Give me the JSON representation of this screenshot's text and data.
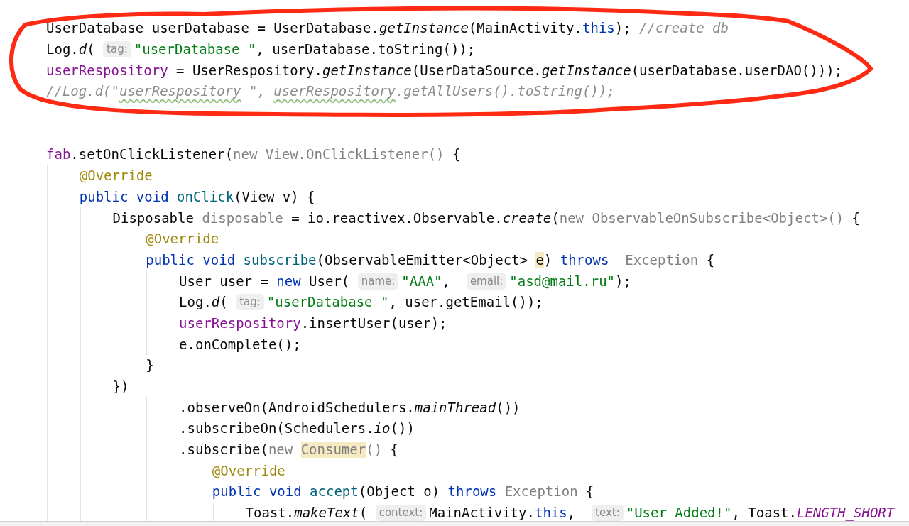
{
  "editor": {
    "lines": [
      {
        "kind": "code",
        "tokens": [
          {
            "kind": "code",
            "text": "UserDatabase userDatabase = UserDatabase.",
            "color": "#080808"
          },
          {
            "kind": "code",
            "text": "getInstance",
            "color": "#080808",
            "italic": true
          },
          {
            "kind": "code",
            "text": "(MainActivity.",
            "color": "#080808"
          },
          {
            "kind": "code",
            "text": "this",
            "color": "#0033b3"
          },
          {
            "kind": "code",
            "text": "); ",
            "color": "#080808"
          },
          {
            "kind": "code",
            "text": "//create db",
            "color": "#8c8c8c",
            "italic": true
          }
        ]
      },
      {
        "kind": "code",
        "tokens": [
          {
            "kind": "code",
            "text": "Log.",
            "color": "#080808"
          },
          {
            "kind": "code",
            "text": "d",
            "color": "#080808",
            "italic": true
          },
          {
            "kind": "code",
            "text": "( ",
            "color": "#080808"
          },
          {
            "kind": "hint",
            "text": "tag:"
          },
          {
            "kind": "code",
            "text": "\"userDatabase \"",
            "color": "#067d17"
          },
          {
            "kind": "code",
            "text": ", userDatabase.toString());",
            "color": "#080808"
          }
        ]
      },
      {
        "kind": "code",
        "tokens": [
          {
            "kind": "code",
            "text": "userRespository",
            "color": "#871094"
          },
          {
            "kind": "code",
            "text": " = UserRespository.",
            "color": "#080808"
          },
          {
            "kind": "code",
            "text": "getInstance",
            "color": "#080808",
            "italic": true
          },
          {
            "kind": "code",
            "text": "(UserDataSource.",
            "color": "#080808"
          },
          {
            "kind": "code",
            "text": "getInstance",
            "color": "#080808",
            "italic": true
          },
          {
            "kind": "code",
            "text": "(userDatabase.userDAO()));",
            "color": "#080808"
          }
        ]
      },
      {
        "kind": "code",
        "tokens": [
          {
            "kind": "code",
            "text": "//Log.d(\"",
            "color": "#8c8c8c",
            "italic": true
          },
          {
            "kind": "code",
            "text": "userRespository",
            "color": "#8c8c8c",
            "italic": true,
            "misspelled": true
          },
          {
            "kind": "code",
            "text": " \", ",
            "color": "#8c8c8c",
            "italic": true
          },
          {
            "kind": "code",
            "text": "userRespository",
            "color": "#8c8c8c",
            "italic": true,
            "misspelled": true
          },
          {
            "kind": "code",
            "text": ".getAllUsers().toString());",
            "color": "#8c8c8c",
            "italic": true
          }
        ]
      },
      {
        "kind": "blank"
      },
      {
        "kind": "blank"
      },
      {
        "kind": "code",
        "tokens": [
          {
            "kind": "code",
            "text": "fab",
            "color": "#871094"
          },
          {
            "kind": "code",
            "text": ".setOnClickListener(",
            "color": "#080808"
          },
          {
            "kind": "code",
            "text": "new View.OnClickListener()",
            "color": "#808080"
          },
          {
            "kind": "code",
            "text": " {",
            "color": "#080808"
          }
        ]
      },
      {
        "kind": "code",
        "tokens": [
          {
            "kind": "code",
            "text": "    @Override",
            "color": "#9e880d"
          }
        ]
      },
      {
        "kind": "code",
        "tokens": [
          {
            "kind": "code",
            "text": "    public void ",
            "color": "#0033b3"
          },
          {
            "kind": "code",
            "text": "onClick",
            "color": "#00627a"
          },
          {
            "kind": "code",
            "text": "(View v) {",
            "color": "#080808"
          }
        ]
      },
      {
        "kind": "code",
        "tokens": [
          {
            "kind": "code",
            "text": "        Disposable ",
            "color": "#080808"
          },
          {
            "kind": "code",
            "text": "disposable",
            "color": "#808080"
          },
          {
            "kind": "code",
            "text": " = io.reactivex.Observable.",
            "color": "#080808"
          },
          {
            "kind": "code",
            "text": "create",
            "color": "#080808",
            "italic": true
          },
          {
            "kind": "code",
            "text": "(",
            "color": "#080808"
          },
          {
            "kind": "code",
            "text": "new ObservableOnSubscribe<Object>()",
            "color": "#808080"
          },
          {
            "kind": "code",
            "text": " {",
            "color": "#080808"
          }
        ]
      },
      {
        "kind": "code",
        "tokens": [
          {
            "kind": "code",
            "text": "            @Override",
            "color": "#9e880d"
          }
        ]
      },
      {
        "kind": "code",
        "tokens": [
          {
            "kind": "code",
            "text": "            public void ",
            "color": "#0033b3"
          },
          {
            "kind": "code",
            "text": "subscribe",
            "color": "#00627a"
          },
          {
            "kind": "code",
            "text": "(ObservableEmitter<Object> ",
            "color": "#080808"
          },
          {
            "kind": "code",
            "text": "e",
            "color": "#080808",
            "highlighted": true
          },
          {
            "kind": "code",
            "text": ") ",
            "color": "#080808"
          },
          {
            "kind": "code",
            "text": "throws",
            "color": "#0033b3"
          },
          {
            "kind": "code",
            "text": "  Exception",
            "color": "#808080"
          },
          {
            "kind": "code",
            "text": " {",
            "color": "#080808"
          }
        ]
      },
      {
        "kind": "code",
        "tokens": [
          {
            "kind": "code",
            "text": "                User user = ",
            "color": "#080808"
          },
          {
            "kind": "code",
            "text": "new",
            "color": "#0033b3"
          },
          {
            "kind": "code",
            "text": " User( ",
            "color": "#080808"
          },
          {
            "kind": "hint",
            "text": "name:"
          },
          {
            "kind": "code",
            "text": "\"AAA\"",
            "color": "#067d17"
          },
          {
            "kind": "code",
            "text": ",  ",
            "color": "#080808"
          },
          {
            "kind": "hint",
            "text": "email:"
          },
          {
            "kind": "code",
            "text": "\"asd@mail.ru\"",
            "color": "#067d17"
          },
          {
            "kind": "code",
            "text": ");",
            "color": "#080808"
          }
        ]
      },
      {
        "kind": "code",
        "tokens": [
          {
            "kind": "code",
            "text": "                Log.",
            "color": "#080808"
          },
          {
            "kind": "code",
            "text": "d",
            "color": "#080808",
            "italic": true
          },
          {
            "kind": "code",
            "text": "( ",
            "color": "#080808"
          },
          {
            "kind": "hint",
            "text": "tag:"
          },
          {
            "kind": "code",
            "text": "\"userDatabase \"",
            "color": "#067d17"
          },
          {
            "kind": "code",
            "text": ", user.getEmail());",
            "color": "#080808"
          }
        ]
      },
      {
        "kind": "code",
        "tokens": [
          {
            "kind": "code",
            "text": "                userRespository",
            "color": "#871094"
          },
          {
            "kind": "code",
            "text": ".insertUser(user);",
            "color": "#080808"
          }
        ]
      },
      {
        "kind": "code",
        "tokens": [
          {
            "kind": "code",
            "text": "                e.onComplete();",
            "color": "#080808"
          }
        ]
      },
      {
        "kind": "code",
        "tokens": [
          {
            "kind": "code",
            "text": "            }",
            "color": "#080808"
          }
        ]
      },
      {
        "kind": "code",
        "tokens": [
          {
            "kind": "code",
            "text": "        })",
            "color": "#080808"
          }
        ]
      },
      {
        "kind": "code",
        "tokens": [
          {
            "kind": "code",
            "text": "                .observeOn(AndroidSchedulers.",
            "color": "#080808"
          },
          {
            "kind": "code",
            "text": "mainThread",
            "color": "#080808",
            "italic": true
          },
          {
            "kind": "code",
            "text": "())",
            "color": "#080808"
          }
        ]
      },
      {
        "kind": "code",
        "tokens": [
          {
            "kind": "code",
            "text": "                .subscribeOn(Schedulers.",
            "color": "#080808"
          },
          {
            "kind": "code",
            "text": "io",
            "color": "#080808",
            "italic": true
          },
          {
            "kind": "code",
            "text": "())",
            "color": "#080808"
          }
        ]
      },
      {
        "kind": "code",
        "tokens": [
          {
            "kind": "code",
            "text": "                .subscribe(",
            "color": "#080808"
          },
          {
            "kind": "code",
            "text": "new ",
            "color": "#808080"
          },
          {
            "kind": "code",
            "text": "Consumer",
            "color": "#808080",
            "highlighted": true
          },
          {
            "kind": "code",
            "text": "()",
            "color": "#808080"
          },
          {
            "kind": "code",
            "text": " {",
            "color": "#080808"
          }
        ]
      },
      {
        "kind": "code",
        "tokens": [
          {
            "kind": "code",
            "text": "                    @Override",
            "color": "#9e880d"
          }
        ]
      },
      {
        "kind": "code",
        "tokens": [
          {
            "kind": "code",
            "text": "                    public void ",
            "color": "#0033b3"
          },
          {
            "kind": "code",
            "text": "accept",
            "color": "#00627a"
          },
          {
            "kind": "code",
            "text": "(Object o) ",
            "color": "#080808"
          },
          {
            "kind": "code",
            "text": "throws",
            "color": "#0033b3"
          },
          {
            "kind": "code",
            "text": " Exception",
            "color": "#808080"
          },
          {
            "kind": "code",
            "text": " {",
            "color": "#080808"
          }
        ]
      },
      {
        "kind": "code",
        "tokens": [
          {
            "kind": "code",
            "text": "                        Toast.",
            "color": "#080808"
          },
          {
            "kind": "code",
            "text": "makeText",
            "color": "#080808",
            "italic": true
          },
          {
            "kind": "code",
            "text": "( ",
            "color": "#080808"
          },
          {
            "kind": "hint",
            "text": "context:"
          },
          {
            "kind": "code",
            "text": "MainActivity.",
            "color": "#080808"
          },
          {
            "kind": "code",
            "text": "this",
            "color": "#0033b3"
          },
          {
            "kind": "code",
            "text": ",  ",
            "color": "#080808"
          },
          {
            "kind": "hint",
            "text": "text:"
          },
          {
            "kind": "code",
            "text": "\"User Added!\"",
            "color": "#067d17"
          },
          {
            "kind": "code",
            "text": ", Toast.",
            "color": "#080808"
          },
          {
            "kind": "code",
            "text": "LENGTH_SHORT",
            "color": "#871094",
            "italic": true
          }
        ]
      }
    ]
  },
  "annotation": {
    "kind": "freehand-circle"
  }
}
